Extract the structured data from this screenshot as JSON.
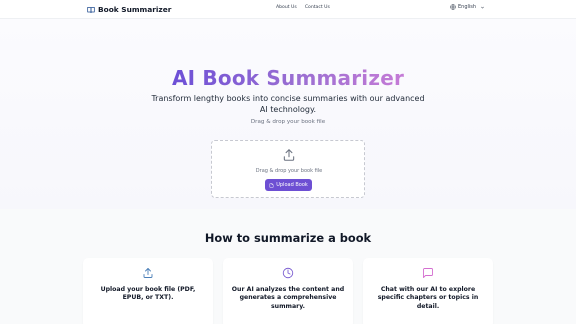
{
  "nav": {
    "brand": "Book Summarizer",
    "links": [
      "About Us",
      "Contact Us"
    ],
    "language": "English"
  },
  "hero": {
    "title": "AI Book Summarizer",
    "subtitle": "Transform lengthy books into concise summaries with our advanced AI technology.",
    "hint": "Drag & drop your book file"
  },
  "dropzone": {
    "text": "Drag & drop your book file",
    "button_label": "Upload Book"
  },
  "how": {
    "title": "How to summarize a book",
    "steps": [
      {
        "icon": "upload-icon",
        "text": "Upload your book file (PDF, EPUB, or TXT)."
      },
      {
        "icon": "clock-icon",
        "text": "Our AI analyzes the content and generates a comprehensive summary."
      },
      {
        "icon": "chat-icon",
        "text": "Chat with our AI to explore specific chapters or topics in detail."
      }
    ]
  },
  "colors": {
    "accent": "#6d4fd3",
    "icon_blue": "#4b7fb8",
    "icon_purple": "#7c5fd1",
    "icon_pink": "#d46fd0"
  }
}
